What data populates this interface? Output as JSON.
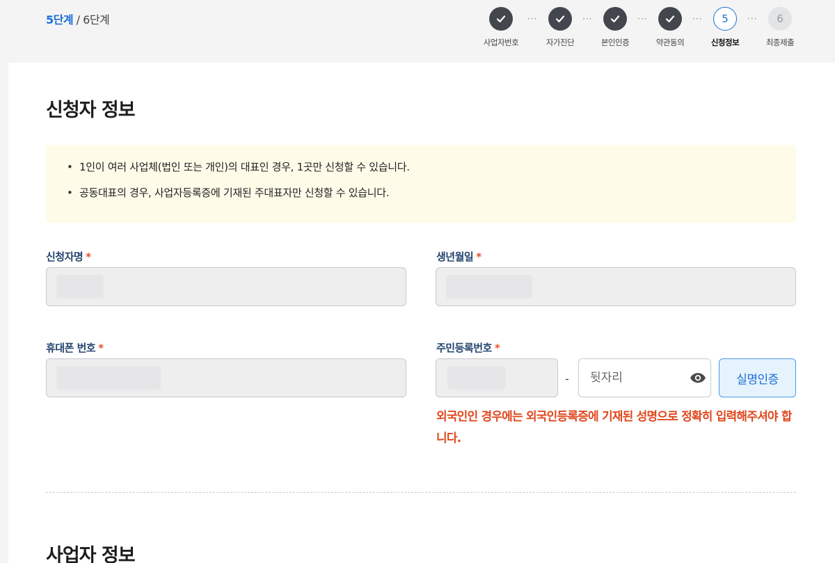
{
  "header": {
    "current_step": "5단계",
    "separator": " / ",
    "total_steps": "6단계"
  },
  "stepper": {
    "steps": [
      {
        "label": "사업자번호",
        "state": "done",
        "icon": "check-icon"
      },
      {
        "label": "자가진단",
        "state": "done",
        "icon": "check-icon"
      },
      {
        "label": "본인인증",
        "state": "done",
        "icon": "check-icon"
      },
      {
        "label": "약관동의",
        "state": "done",
        "icon": "check-icon"
      },
      {
        "label": "신청정보",
        "state": "active",
        "number": "5"
      },
      {
        "label": "최종제출",
        "state": "todo",
        "number": "6"
      }
    ],
    "connector": "···"
  },
  "applicant_section": {
    "title": "신청자 정보",
    "notices": [
      "1인이 여러 사업체(법인 또는 개인)의 대표인 경우, 1곳만 신청할 수 있습니다.",
      "공동대표의 경우, 사업자등록증에 기재된 주대표자만 신청할 수 있습니다."
    ],
    "fields": {
      "name_label": "신청자명",
      "birth_label": "생년월일",
      "phone_label": "휴대폰 번호",
      "rrn_label": "주민등록번호",
      "required_mark": "*",
      "rrn_dash": "-",
      "rrn_back_placeholder": "뒷자리"
    },
    "verify_button": "실명인증",
    "warning": "외국인인 경우에는 외국인등록증에 기재된 성명으로 정확히 입력해주셔야 합니다."
  },
  "business_section": {
    "title": "사업자 정보"
  },
  "colors": {
    "accent": "#1a6fd6",
    "done_step": "#43474d",
    "required": "#e5512d",
    "warning": "#e0471d",
    "notice_bg": "#fffbe9",
    "label": "#25456e"
  }
}
